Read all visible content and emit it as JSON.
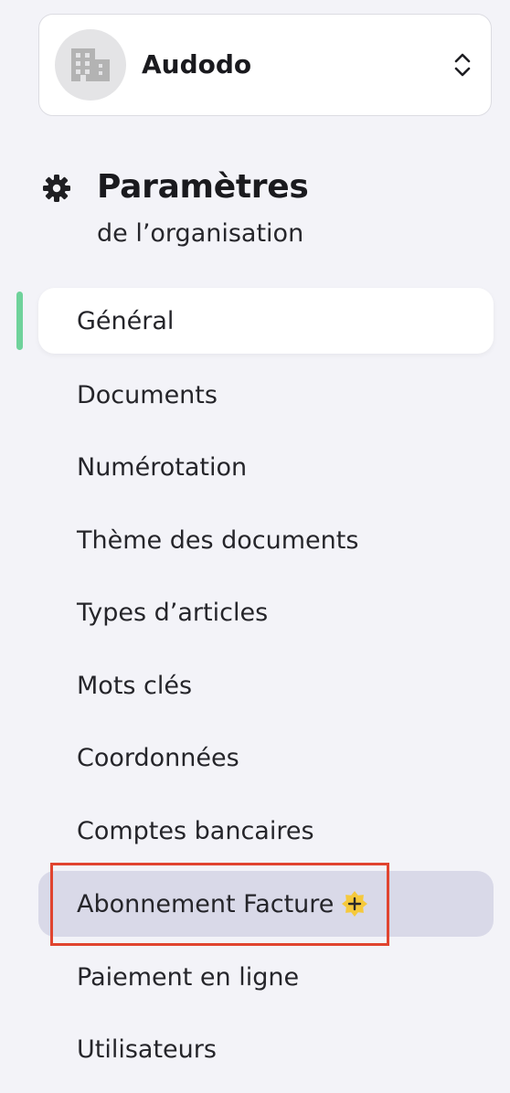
{
  "org_switcher": {
    "name": "Audodo",
    "avatar_icon": "building-icon",
    "toggle_icon": "chevron-up-down-icon"
  },
  "settings": {
    "icon": "gear-icon",
    "title": "Paramètres",
    "subtitle": "de l’organisation"
  },
  "nav": {
    "items": [
      {
        "label": "Général",
        "state": "active"
      },
      {
        "label": "Documents"
      },
      {
        "label": "Numérotation"
      },
      {
        "label": "Thème des documents"
      },
      {
        "label": "Types d’articles"
      },
      {
        "label": "Mots clés"
      },
      {
        "label": "Coordonnées"
      },
      {
        "label": "Comptes bancaires"
      },
      {
        "label": "Abonnement Facture",
        "state": "hovered",
        "badge_icon": "plus-badge-icon"
      },
      {
        "label": "Paiement en ligne"
      },
      {
        "label": "Utilisateurs"
      }
    ]
  },
  "colors": {
    "background": "#f3f3f8",
    "active_indicator": "#6fd29b",
    "hover_background": "#d9d9e8",
    "highlight_border": "#e0442f",
    "badge": "#f5c93c"
  }
}
